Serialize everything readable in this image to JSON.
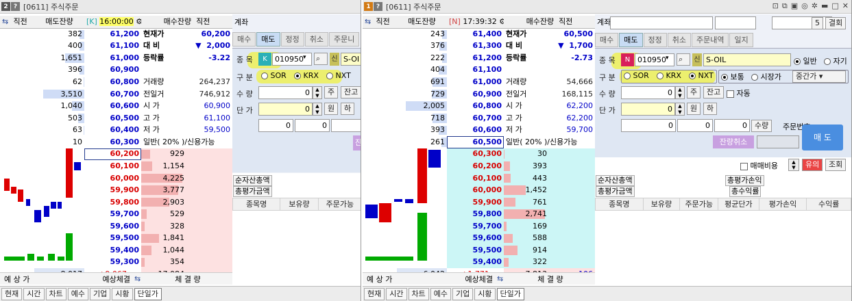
{
  "left": {
    "title": {
      "num": "2",
      "q": "?",
      "text": "[0611] 주식주문"
    },
    "header": {
      "c1": "직전",
      "c2": "매도잔량",
      "market": "[K]",
      "time": "16:00:00",
      "c5": "매수잔량",
      "c6": "직전"
    },
    "asks": [
      {
        "q": "382",
        "p": "61,200"
      },
      {
        "q": "400",
        "p": "61,100"
      },
      {
        "q": "1,651",
        "p": "61,000"
      },
      {
        "q": "396",
        "p": "60,900"
      },
      {
        "q": "62",
        "p": "60,800"
      },
      {
        "q": "3,510",
        "p": "60,700"
      },
      {
        "q": "1,040",
        "p": "60,600"
      },
      {
        "q": "503",
        "p": "60,500"
      },
      {
        "q": "63",
        "p": "60,400"
      },
      {
        "q": "10",
        "p": "60,300"
      }
    ],
    "bids": [
      {
        "p": "60,200",
        "q": "929"
      },
      {
        "p": "60,100",
        "q": "1,154"
      },
      {
        "p": "60,000",
        "q": "4,225"
      },
      {
        "p": "59,900",
        "q": "3,777"
      },
      {
        "p": "59,800",
        "q": "2,903"
      },
      {
        "p": "59,700",
        "q": "529"
      },
      {
        "p": "59,600",
        "q": "328"
      },
      {
        "p": "59,500",
        "q": "1,841"
      },
      {
        "p": "59,400",
        "q": "1,044"
      },
      {
        "p": "59,300",
        "q": "354"
      }
    ],
    "info": [
      {
        "k": "현재가",
        "v": "60,200"
      },
      {
        "k": "대 비",
        "v": "2,000",
        "arrow": "▼"
      },
      {
        "k": "등락률",
        "v": "-3.22"
      },
      {
        "k": "",
        "v": ""
      },
      {
        "k": "거래량",
        "v": "264,237"
      },
      {
        "k": "전일거",
        "v": "746,912"
      },
      {
        "k": "시 가",
        "v": "60,900"
      },
      {
        "k": "고 가",
        "v": "61,100"
      },
      {
        "k": "저 가",
        "v": "59,500"
      },
      {
        "k": "일반( 20% )/신용가능",
        "v": ""
      }
    ],
    "totals": {
      "ask": "8,017",
      "diff": "+9,067",
      "bid": "17,084"
    },
    "foot": {
      "a": "예 상 가",
      "b": "예상체결",
      "c": "체 결 량"
    },
    "acct": "계좌",
    "tabs": [
      "매수",
      "매도",
      "정정",
      "취소",
      "주문니"
    ],
    "form": {
      "code_label": "종 목",
      "code_badge": "K",
      "code": "010950",
      "sin": "신",
      "name": "S-OI",
      "gubun": "구 분",
      "sor": "SOR",
      "krx": "KRX",
      "nxt": "NXT",
      "qty": "수 량",
      "qty_val": "0",
      "ju": "주",
      "jango": "잔고",
      "price": "단 가",
      "price_val": "0",
      "won": "원",
      "ha": "하",
      "n1": "0",
      "n2": "0",
      "jan": "잔"
    },
    "list": {
      "a": "순자산총액",
      "b": "총평가금액",
      "cols": [
        "종목명",
        "보유량",
        "주문가능"
      ]
    },
    "tabs_bottom": [
      "현재",
      "시간",
      "차트",
      "예수",
      "기업",
      "시황",
      "단일가"
    ]
  },
  "right": {
    "title": {
      "num": "1",
      "q": "?",
      "text": "[0611] 주식주문"
    },
    "header": {
      "c1": "직전",
      "c2": "매도잔량",
      "market": "[N]",
      "time": "17:39:32",
      "c5": "매수잔량",
      "c6": "직전"
    },
    "asks": [
      {
        "q": "243",
        "p": "61,400"
      },
      {
        "q": "376",
        "p": "61,300"
      },
      {
        "q": "222",
        "p": "61,200"
      },
      {
        "q": "404",
        "p": "61,100"
      },
      {
        "q": "691",
        "p": "61,000"
      },
      {
        "q": "729",
        "p": "60,900"
      },
      {
        "q": "2,005",
        "p": "60,800"
      },
      {
        "q": "718",
        "p": "60,700"
      },
      {
        "q": "393",
        "p": "60,600"
      },
      {
        "q": "261",
        "p": "60,500"
      }
    ],
    "bids": [
      {
        "p": "60,300",
        "q": "30"
      },
      {
        "p": "60,200",
        "q": "393"
      },
      {
        "p": "60,100",
        "q": "443"
      },
      {
        "p": "60,000",
        "q": "1,452"
      },
      {
        "p": "59,900",
        "q": "761"
      },
      {
        "p": "59,800",
        "q": "2,741"
      },
      {
        "p": "59,700",
        "q": "169"
      },
      {
        "p": "59,600",
        "q": "588"
      },
      {
        "p": "59,500",
        "q": "914"
      },
      {
        "p": "59,400",
        "q": "322"
      }
    ],
    "info": [
      {
        "k": "현재가",
        "v": "60,500"
      },
      {
        "k": "대 비",
        "v": "1,700",
        "arrow": "▼"
      },
      {
        "k": "등락률",
        "v": "-2.73"
      },
      {
        "k": "",
        "v": ""
      },
      {
        "k": "거래량",
        "v": "54,666"
      },
      {
        "k": "전일거",
        "v": "168,115"
      },
      {
        "k": "시 가",
        "v": "62,200"
      },
      {
        "k": "고 가",
        "v": "62,200"
      },
      {
        "k": "저 가",
        "v": "59,700"
      },
      {
        "k": "일반( 20% )/신용가능",
        "v": ""
      }
    ],
    "totals": {
      "ask": "6,042",
      "diff": "+1,771",
      "bid": "7,813",
      "extra": "-106"
    },
    "foot": {
      "a": "예 상 가",
      "b": "예상체결",
      "c": "체 결 량"
    },
    "acct": "계좌",
    "counter": "5",
    "close": "결회",
    "tabs": [
      "매수",
      "매도",
      "정정",
      "취소",
      "주문내역",
      "일지"
    ],
    "form": {
      "code_label": "종 목",
      "code_badge": "N",
      "code": "010950",
      "sin": "신",
      "name": "S-OIL",
      "normal": "일반",
      "self": "자기",
      "gubun": "구 분",
      "sor": "SOR",
      "krx": "KRX",
      "nxt": "NXT",
      "bo": "보통",
      "sijang": "시장가",
      "jungan": "중간가",
      "qty": "수 량",
      "qty_val": "0",
      "ju": "주",
      "jango": "잔고",
      "auto": "자동",
      "price": "단 가",
      "price_val": "0",
      "won": "원",
      "ha": "하",
      "n1": "0",
      "n2": "0",
      "n3": "0",
      "suryang": "수량",
      "order_no": "주문번호",
      "sell": "매 도",
      "cancel": "잔량취소"
    },
    "misc": {
      "ratio": "매매비용",
      "yui": "유의",
      "jo": "조회"
    },
    "list": {
      "a": "순자산총액",
      "b": "총평가금액",
      "c": "총평가손익",
      "d": "총수익률",
      "cols": [
        "종목명",
        "보유량",
        "주문가능",
        "평균단가",
        "평가손익",
        "수익률"
      ]
    },
    "tabs_bottom": [
      "현재",
      "시간",
      "차트",
      "예수",
      "기업",
      "시황",
      "단일가"
    ]
  }
}
